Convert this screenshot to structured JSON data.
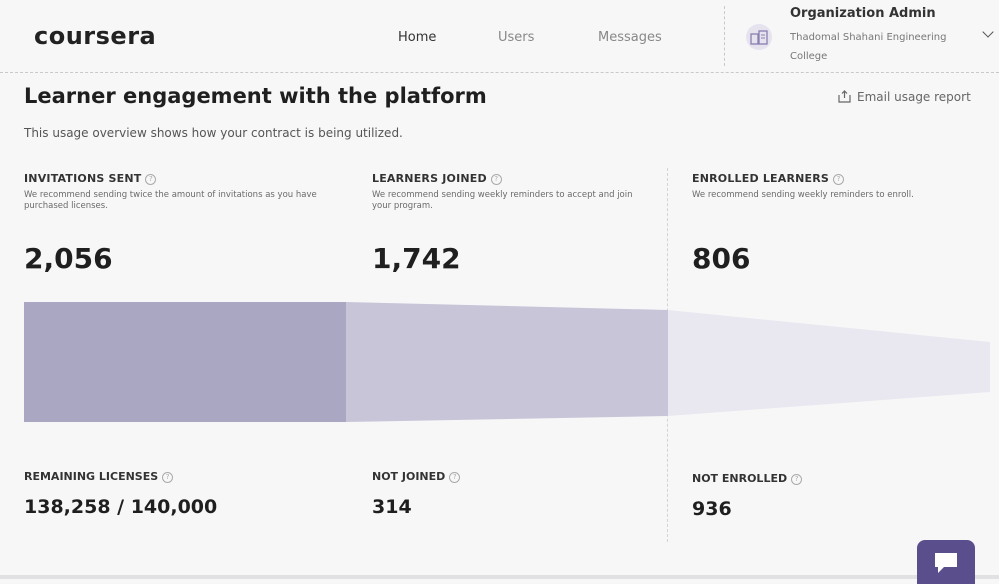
{
  "header": {
    "logo": "coursera",
    "nav": {
      "home": "Home",
      "users": "Users",
      "messages": "Messages"
    },
    "org": {
      "title": "Organization Admin",
      "name": "Thadomal Shahani Engineering College"
    }
  },
  "page": {
    "title": "Learner engagement with the platform",
    "email_report": "Email usage report",
    "subtitle": "This usage overview shows how your contract is being utilized."
  },
  "metrics": [
    {
      "label": "INVITATIONS SENT",
      "description": "We recommend sending twice the amount of invitations as you have purchased licenses.",
      "value": "2,056"
    },
    {
      "label": "LEARNERS JOINED",
      "description": "We recommend sending weekly reminders to accept and join your program.",
      "value": "1,742"
    },
    {
      "label": "ENROLLED LEARNERS",
      "description": "We recommend sending weekly reminders to enroll.",
      "value": "806"
    }
  ],
  "bottom": [
    {
      "label": "REMAINING LICENSES",
      "value": "138,258 / 140,000"
    },
    {
      "label": "NOT JOINED",
      "value": "314"
    },
    {
      "label": "NOT ENROLLED",
      "value": "936"
    }
  ],
  "colors": {
    "funnel_invitations": "#a9a7c2",
    "funnel_joined": "#c8c5d8",
    "funnel_enrolled": "#e9e8f0",
    "accent": "#5a4e8d"
  },
  "icons": {
    "org": "org-building-icon",
    "email": "export-icon",
    "help": "help-circle-icon",
    "chat": "chat-icon"
  }
}
